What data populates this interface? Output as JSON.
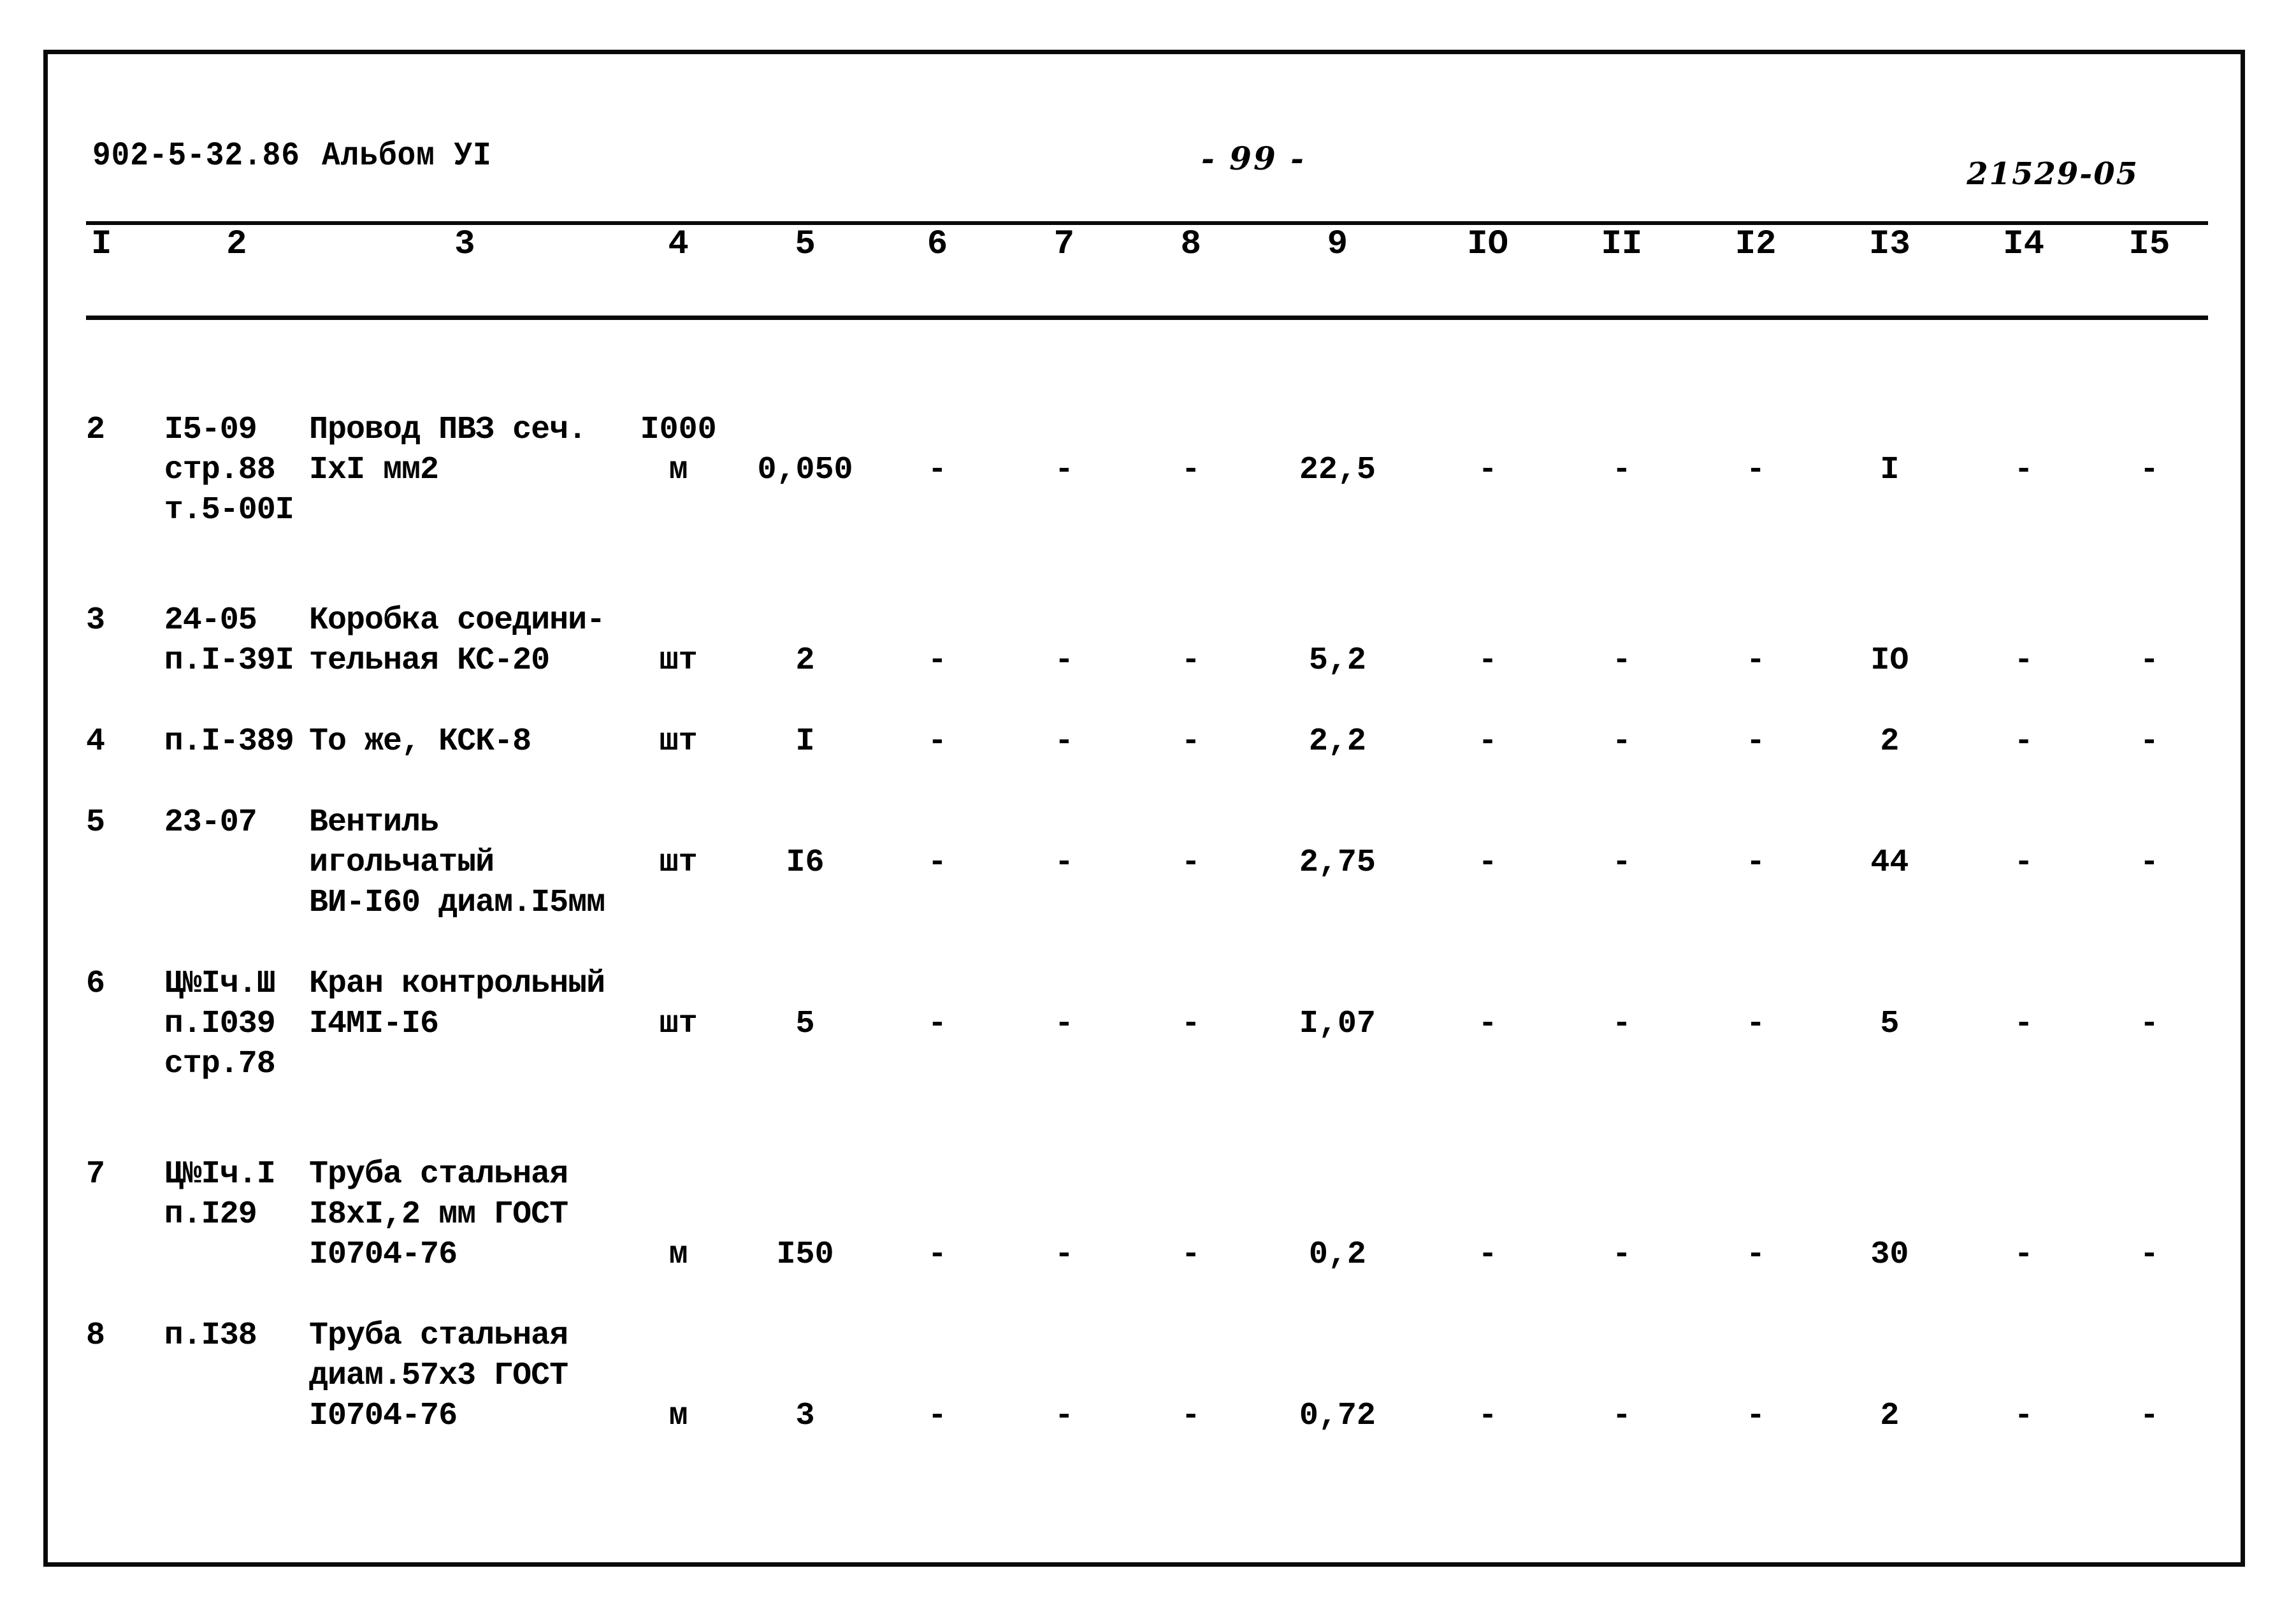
{
  "header": {
    "doc_code": "902-5-32.86",
    "album_label": "Альбом УI",
    "page_number": "- 99 -",
    "sheet_code": "21529-05"
  },
  "table": {
    "column_headers": [
      "I",
      "2",
      "3",
      "4",
      "5",
      "6",
      "7",
      "8",
      "9",
      "IO",
      "II",
      "I2",
      "I3",
      "I4",
      "I5"
    ],
    "rows": [
      {
        "pos": "2",
        "code": "I5-09\nстр.88\nт.5-00I",
        "name": "Провод ПВЗ сеч.\nIxI мм2",
        "unit": "I000\nм",
        "qty": "0,050",
        "c6": "-",
        "c7": "-",
        "c8": "-",
        "c9": "22,5",
        "c10": "-",
        "c11": "-",
        "c12": "-",
        "c13": "I",
        "c14": "-",
        "c15": "-"
      },
      {
        "pos": "3",
        "code": "24-05\nп.I-39I",
        "name": "Коробка соедини-\nтельная КС-20",
        "unit": "шт",
        "qty": "2",
        "c6": "-",
        "c7": "-",
        "c8": "-",
        "c9": "5,2",
        "c10": "-",
        "c11": "-",
        "c12": "-",
        "c13": "IO",
        "c14": "-",
        "c15": "-"
      },
      {
        "pos": "4",
        "code": "п.I-389",
        "name": "То же, КСК-8",
        "unit": "шт",
        "qty": "I",
        "c6": "-",
        "c7": "-",
        "c8": "-",
        "c9": "2,2",
        "c10": "-",
        "c11": "-",
        "c12": "-",
        "c13": "2",
        "c14": "-",
        "c15": "-"
      },
      {
        "pos": "5",
        "code": "23-07",
        "name": "Вентиль игольчатый\nВИ-I60 диам.I5мм",
        "unit": "шт",
        "qty": "I6",
        "c6": "-",
        "c7": "-",
        "c8": "-",
        "c9": "2,75",
        "c10": "-",
        "c11": "-",
        "c12": "-",
        "c13": "44",
        "c14": "-",
        "c15": "-"
      },
      {
        "pos": "6",
        "code": "Ц№Iч.Ш\nп.I039\nстр.78",
        "name": "Кран контрольный\nI4MI-I6",
        "unit": "шт",
        "qty": "5",
        "c6": "-",
        "c7": "-",
        "c8": "-",
        "c9": "I,07",
        "c10": "-",
        "c11": "-",
        "c12": "-",
        "c13": "5",
        "c14": "-",
        "c15": "-"
      },
      {
        "pos": "7",
        "code": "Ц№Iч.I\nп.I29",
        "name": "Труба стальная\nI8xI,2 мм ГОСТ\nI0704-76",
        "unit": "м",
        "qty": "I50",
        "c6": "-",
        "c7": "-",
        "c8": "-",
        "c9": "0,2",
        "c10": "-",
        "c11": "-",
        "c12": "-",
        "c13": "30",
        "c14": "-",
        "c15": "-"
      },
      {
        "pos": "8",
        "code": "п.I38",
        "name": "Труба стальная\nдиам.57х3 ГОСТ\nI0704-76",
        "unit": "м",
        "qty": "3",
        "c6": "-",
        "c7": "-",
        "c8": "-",
        "c9": "0,72",
        "c10": "-",
        "c11": "-",
        "c12": "-",
        "c13": "2",
        "c14": "-",
        "c15": "-"
      }
    ]
  }
}
